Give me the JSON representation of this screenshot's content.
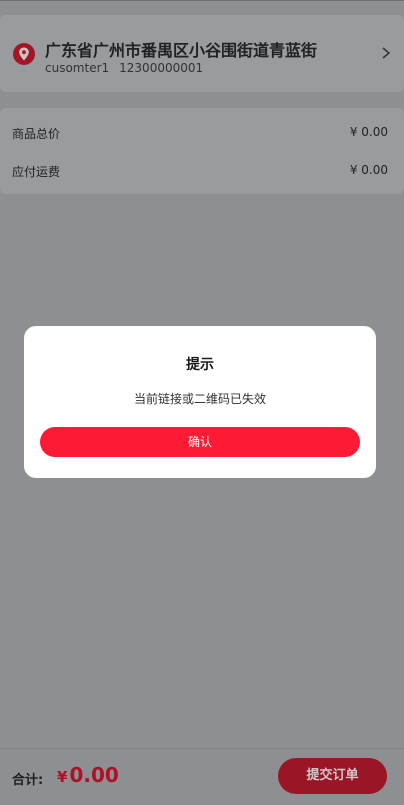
{
  "address": {
    "full": "广东省广州市番禺区小谷围街道青蓝街",
    "name": "cusomter1",
    "phone": "12300000001"
  },
  "summary": {
    "goods_label": "商品总价",
    "goods_value": "¥ 0.00",
    "shipping_label": "应付运费",
    "shipping_value": "¥ 0.00"
  },
  "bottom": {
    "total_label": "合计:",
    "currency": "¥",
    "amount": "0.00",
    "submit_label": "提交订单"
  },
  "dialog": {
    "title": "提示",
    "message": "当前链接或二维码已失效",
    "confirm_label": "确认"
  },
  "colors": {
    "accent": "#fd1a35",
    "price": "#b10f25",
    "overlay": "#8e8f92"
  }
}
